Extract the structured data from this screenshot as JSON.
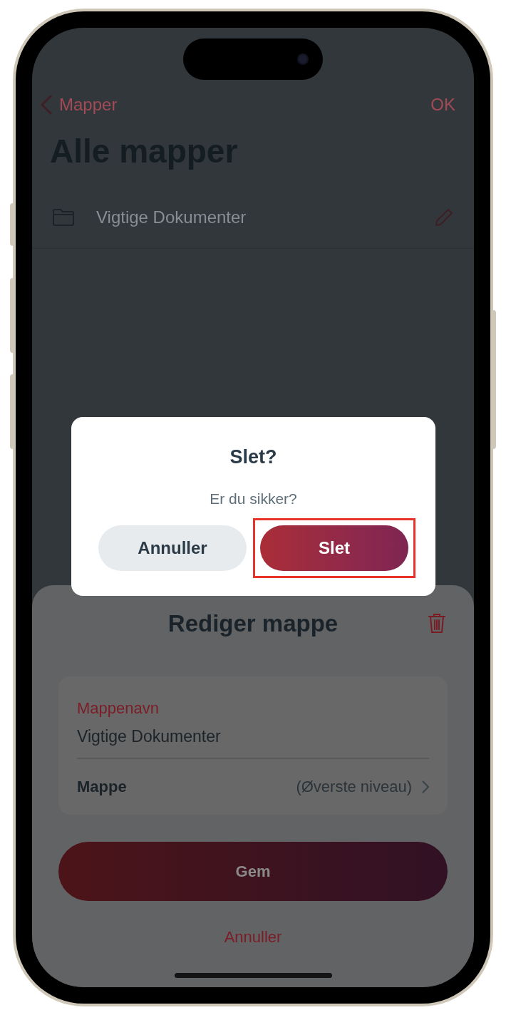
{
  "nav": {
    "back_label": "Mapper",
    "done_label": "OK"
  },
  "title": "Alle mapper",
  "folders": [
    {
      "name": "Vigtige Dokumenter"
    }
  ],
  "sheet": {
    "title": "Rediger mappe",
    "name_field": {
      "label": "Mappenavn",
      "value": "Vigtige Dokumenter"
    },
    "parent_row": {
      "label": "Mappe",
      "value": "(Øverste niveau)"
    },
    "save_button": "Gem",
    "cancel_link": "Annuller"
  },
  "dialog": {
    "title": "Slet?",
    "message": "Er du sikker?",
    "buttons": [
      {
        "label": "Annuller",
        "kind": "secondary",
        "highlighted": false
      },
      {
        "label": "Slet",
        "kind": "destructive",
        "highlighted": true
      }
    ]
  }
}
